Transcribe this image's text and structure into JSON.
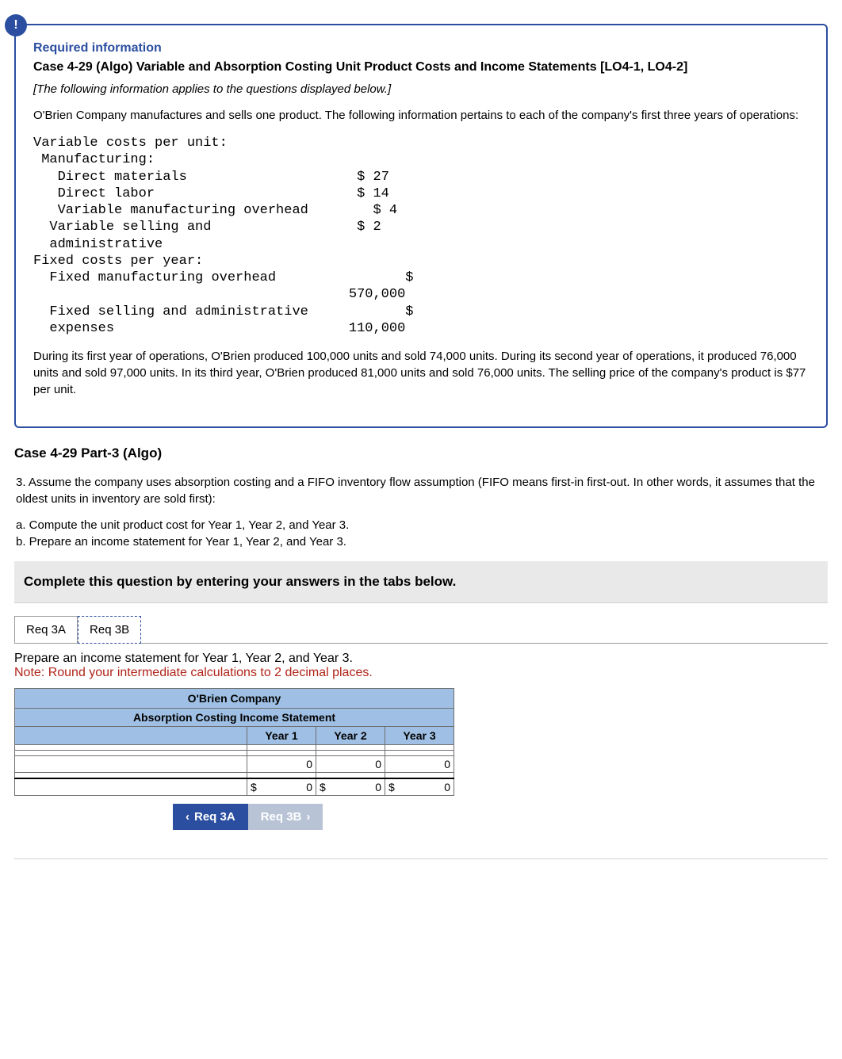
{
  "badge": "!",
  "required_info_title": "Required information",
  "case_title": "Case 4-29 (Algo) Variable and Absorption Costing Unit Product Costs and Income Statements [LO4-1, LO4-2]",
  "intro_italic": "[The following information applies to the questions displayed below.]",
  "para1": "O'Brien Company manufactures and sells one product. The following information pertains to each of the company's first three years of operations:",
  "cost_table": {
    "h_var": "Variable costs per unit:",
    "h_mfg": "Manufacturing:",
    "dm_label": "Direct materials",
    "dm_val": "$ 27",
    "dl_label": "Direct labor",
    "dl_val": "$ 14",
    "vmo_label": "Variable manufacturing overhead",
    "vmo_val": "$ 4",
    "vsa_label1": "Variable selling and",
    "vsa_label2": "administrative",
    "vsa_val": "$ 2",
    "h_fix": "Fixed costs per year:",
    "fmo_label": "Fixed manufacturing overhead",
    "fmo_val1": "$",
    "fmo_val2": "570,000",
    "fsa_label1": "Fixed selling and administrative",
    "fsa_label2": "expenses",
    "fsa_val1": "$",
    "fsa_val2": "110,000"
  },
  "para2": "During its first year of operations, O'Brien produced 100,000 units and sold 74,000 units. During its second year of operations, it produced 76,000 units and sold 97,000 units. In its third year, O'Brien produced 81,000 units and sold 76,000 units. The selling price of the company's product is $77 per unit.",
  "part_title": "Case 4-29 Part-3 (Algo)",
  "q_intro": "3. Assume the company uses absorption costing and a FIFO inventory flow assumption (FIFO means first-in first-out. In other words, it assumes that the oldest units in inventory are sold first):",
  "q_a": "a.  Compute the unit product cost for Year 1, Year 2, and Year 3.",
  "q_b": "b.  Prepare an income statement for Year 1, Year 2, and Year 3.",
  "instruction_bar": "Complete this question by entering your answers in the tabs below.",
  "tabs": {
    "a": "Req 3A",
    "b": "Req 3B"
  },
  "tab_prompt": "Prepare an income statement for Year 1, Year 2, and Year 3.",
  "tab_note": "Note: Round your intermediate calculations to 2 decimal places.",
  "table": {
    "company": "O'Brien Company",
    "subtitle": "Absorption Costing Income Statement",
    "col1": "Year 1",
    "col2": "Year 2",
    "col3": "Year 3",
    "zero": "0",
    "cur": "$"
  },
  "nav": {
    "prev_icon": "‹",
    "prev": "Req 3A",
    "next": "Req 3B",
    "next_icon": "›"
  }
}
